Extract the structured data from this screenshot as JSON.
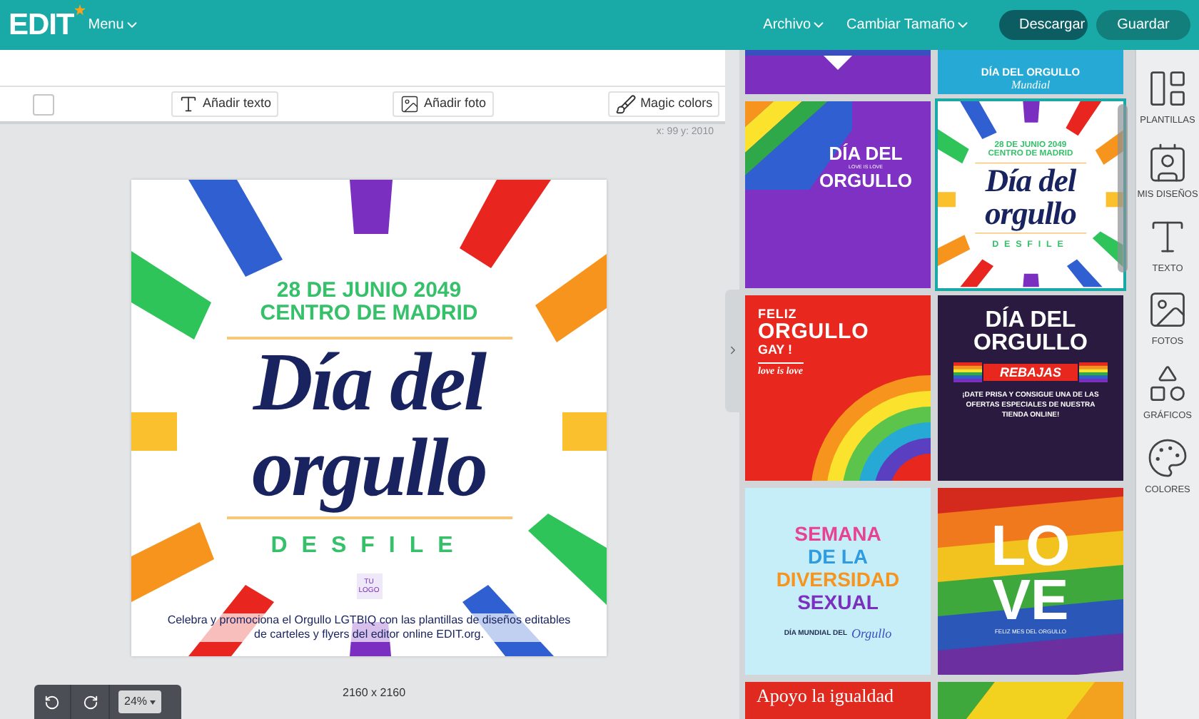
{
  "header": {
    "logo": "EDIT",
    "menu": "Menu",
    "menus": [
      "Archivo",
      "Cambiar Tamaño"
    ],
    "buttons": [
      {
        "label": "Descargar",
        "kind": "primary"
      },
      {
        "label": "Guardar",
        "kind": "secondary"
      }
    ]
  },
  "toolbar": {
    "checkbox": {
      "checked": false
    },
    "tools": [
      {
        "label": "Añadir texto",
        "kind": "text"
      },
      {
        "label": "Añadir foto"
      },
      {
        "label": "Magic colors",
        "kind": "colors"
      }
    ]
  },
  "coordinates": "x: 99 y: 2010",
  "poster": {
    "date": "28 DE JUNIO 2049",
    "place": "CENTRO DE MADRID",
    "title": [
      "Día del",
      "orgullo"
    ],
    "subtitle": "DESFILE",
    "logo": "TU LOGO",
    "caption": "Celebra y promociona el Orgullo LGTBIQ con las plantillas de diseños editables de carteles y flyers del editor online EDIT.org."
  },
  "zoom": "24%",
  "canvas_size": "2160 x 2160",
  "templates": [
    {
      "kind": "purple-top"
    },
    {
      "kind": "blue-banner",
      "texts": [
        "DÍA DEL ORGULLO",
        "Mundial"
      ]
    },
    {
      "kind": "purple-heart",
      "texts": [
        "DÍA DEL",
        "LOVE IS LOVE",
        "ORGULLO"
      ]
    },
    {
      "kind": "poster",
      "selected": true,
      "texts": [
        "28 DE JUNIO 2049",
        "CENTRO DE MADRID",
        "Día del",
        "orgullo",
        "DESFILE"
      ]
    },
    {
      "kind": "red-rainbow",
      "texts": [
        "FELIZ",
        "ORGULLO",
        "GAY !",
        "love is love"
      ]
    },
    {
      "kind": "dark-sale",
      "texts": [
        "DÍA DEL",
        "ORGULLO",
        "REBAJAS",
        "¡DATE PRISA Y CONSIGUE UNA DE LAS OFERTAS ESPECIALES DE NUESTRA TIENDA ONLINE!"
      ]
    },
    {
      "kind": "light-blue",
      "texts": [
        "SEMANA",
        "DE LA",
        "DIVERSIDAD",
        "SEXUAL",
        "DÍA MUNDIAL DEL",
        "Orgullo"
      ]
    },
    {
      "kind": "flag-love",
      "texts": [
        "LO",
        "VE",
        "FELIZ MES DEL ORGULLO"
      ]
    },
    {
      "kind": "red-banner",
      "texts": [
        "Apoyo la igualdad"
      ]
    },
    {
      "kind": "rainbow-bottom"
    }
  ],
  "sidebar": [
    {
      "label": "PLANTILLAS",
      "kind": "templates"
    },
    {
      "label": "MIS DISEÑOS",
      "kind": "designs"
    },
    {
      "label": "TEXTO",
      "kind": "text"
    },
    {
      "label": "FOTOS",
      "kind": "photos"
    },
    {
      "label": "GRÁFICOS",
      "kind": "graphics"
    },
    {
      "label": "COLORES",
      "kind": "colors"
    }
  ]
}
